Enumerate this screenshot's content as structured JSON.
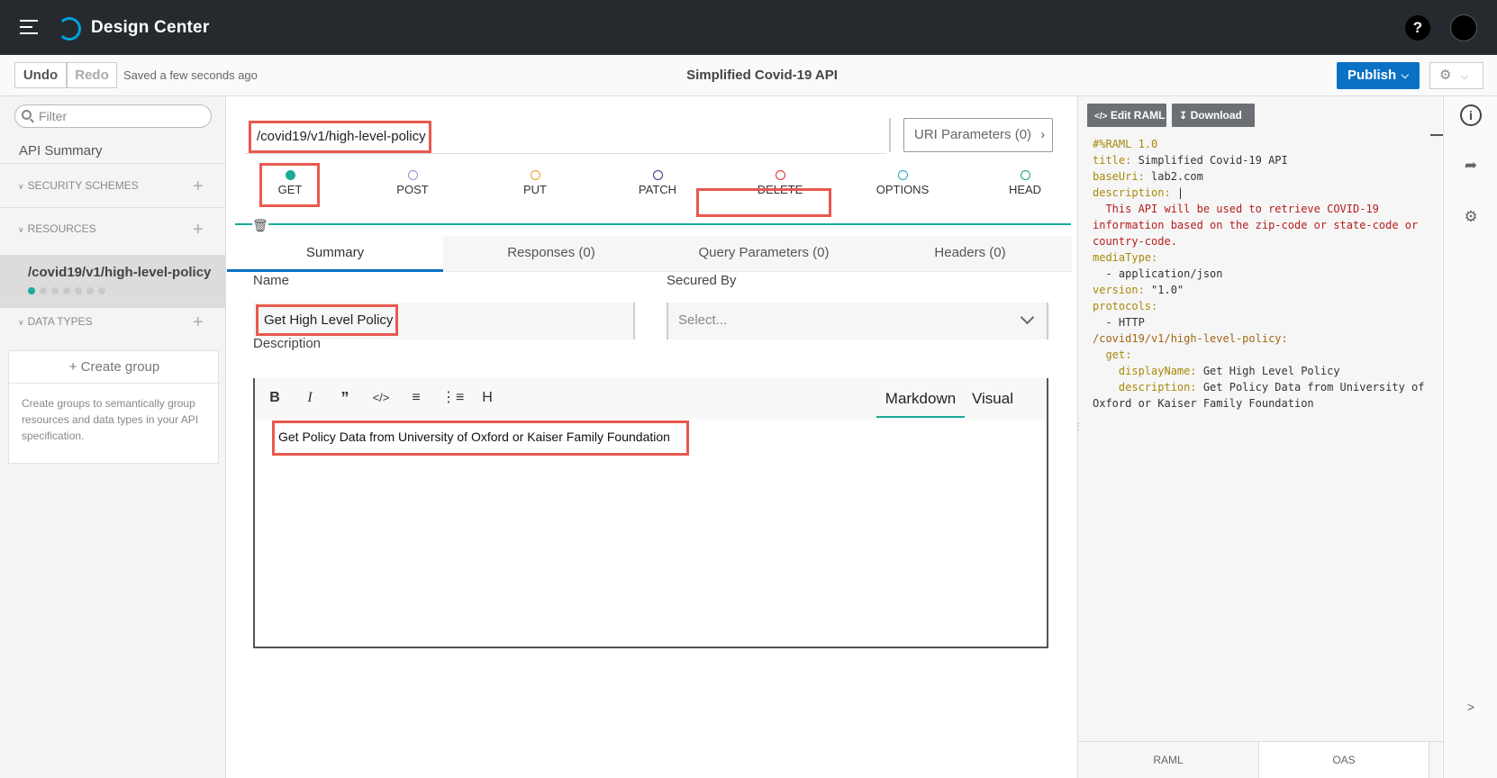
{
  "app": {
    "title": "Design Center",
    "help_label": "?"
  },
  "toolbar": {
    "undo": "Undo",
    "redo": "Redo",
    "saved": "Saved a few seconds ago",
    "title": "Simplified Covid-19 API",
    "publish": "Publish"
  },
  "sidebar": {
    "filter_placeholder": "Filter",
    "api_summary": "API Summary",
    "security_schemes": "SECURITY SCHEMES",
    "resources": "RESOURCES",
    "resource_item": "/covid19/v1/high-level-policy",
    "data_types": "DATA TYPES",
    "create_group": "+ Create group",
    "group_desc": "Create groups to semantically group resources and data types in your API specification."
  },
  "main": {
    "path_value": "/covid19/v1/high-level-policy",
    "uri_params": "URI Parameters (0)",
    "methods": [
      {
        "label": "GET",
        "color": "#1aab9b",
        "filled": true
      },
      {
        "label": "POST",
        "color": "#9a8ad9",
        "filled": false
      },
      {
        "label": "PUT",
        "color": "#e5a019",
        "filled": false
      },
      {
        "label": "PATCH",
        "color": "#33358c",
        "filled": false
      },
      {
        "label": "DELETE",
        "color": "#d9302c",
        "filled": false
      },
      {
        "label": "OPTIONS",
        "color": "#27a7c0",
        "filled": false
      },
      {
        "label": "HEAD",
        "color": "#21a55a",
        "filled": false
      }
    ],
    "tabs": [
      "Summary",
      "Responses (0)",
      "Query Parameters (0)",
      "Headers (0)"
    ],
    "name_label": "Name",
    "name_value": "Get High Level Policy",
    "secured_by_label": "Secured By",
    "secured_by_placeholder": "Select...",
    "description_label": "Description",
    "editor_modes": [
      "Markdown",
      "Visual"
    ],
    "description_value": "Get Policy Data from University of Oxford or Kaiser Family Foundation"
  },
  "right": {
    "edit_raml": "Edit RAML",
    "download": "Download",
    "raml_lines": [
      {
        "parts": [
          [
            "k",
            "#%RAML 1.0"
          ]
        ]
      },
      {
        "parts": [
          [
            "k",
            "title: "
          ],
          [
            "s",
            "Simplified Covid-19 API"
          ]
        ]
      },
      {
        "parts": [
          [
            "k",
            "baseUri: "
          ],
          [
            "s",
            "lab2.com"
          ]
        ]
      },
      {
        "parts": [
          [
            "k",
            "description: "
          ],
          [
            "s",
            "|"
          ]
        ]
      },
      {
        "parts": [
          [
            "r",
            "  This API will be used to retrieve COVID-19 information based on the zip-code or state-code or country-code."
          ]
        ]
      },
      {
        "parts": [
          [
            "k",
            "mediaType:"
          ]
        ]
      },
      {
        "parts": [
          [
            "s",
            "  - application/json"
          ]
        ]
      },
      {
        "parts": [
          [
            "k",
            "version: "
          ],
          [
            "s",
            "\"1.0\""
          ]
        ]
      },
      {
        "parts": [
          [
            "k",
            "protocols:"
          ]
        ]
      },
      {
        "parts": [
          [
            "s",
            "  - HTTP"
          ]
        ]
      },
      {
        "parts": [
          [
            "p",
            "/covid19/v1/high-level-policy:"
          ]
        ]
      },
      {
        "parts": [
          [
            "k",
            "  get:"
          ]
        ]
      },
      {
        "parts": [
          [
            "k",
            "    displayName: "
          ],
          [
            "s",
            "Get High Level Policy"
          ]
        ]
      },
      {
        "parts": [
          [
            "k",
            "    description: "
          ],
          [
            "s",
            "Get Policy Data from University of Oxford or Kaiser Family Foundation"
          ]
        ]
      }
    ],
    "bottom_tabs": [
      "RAML",
      "OAS"
    ],
    "expand_label": ">"
  }
}
